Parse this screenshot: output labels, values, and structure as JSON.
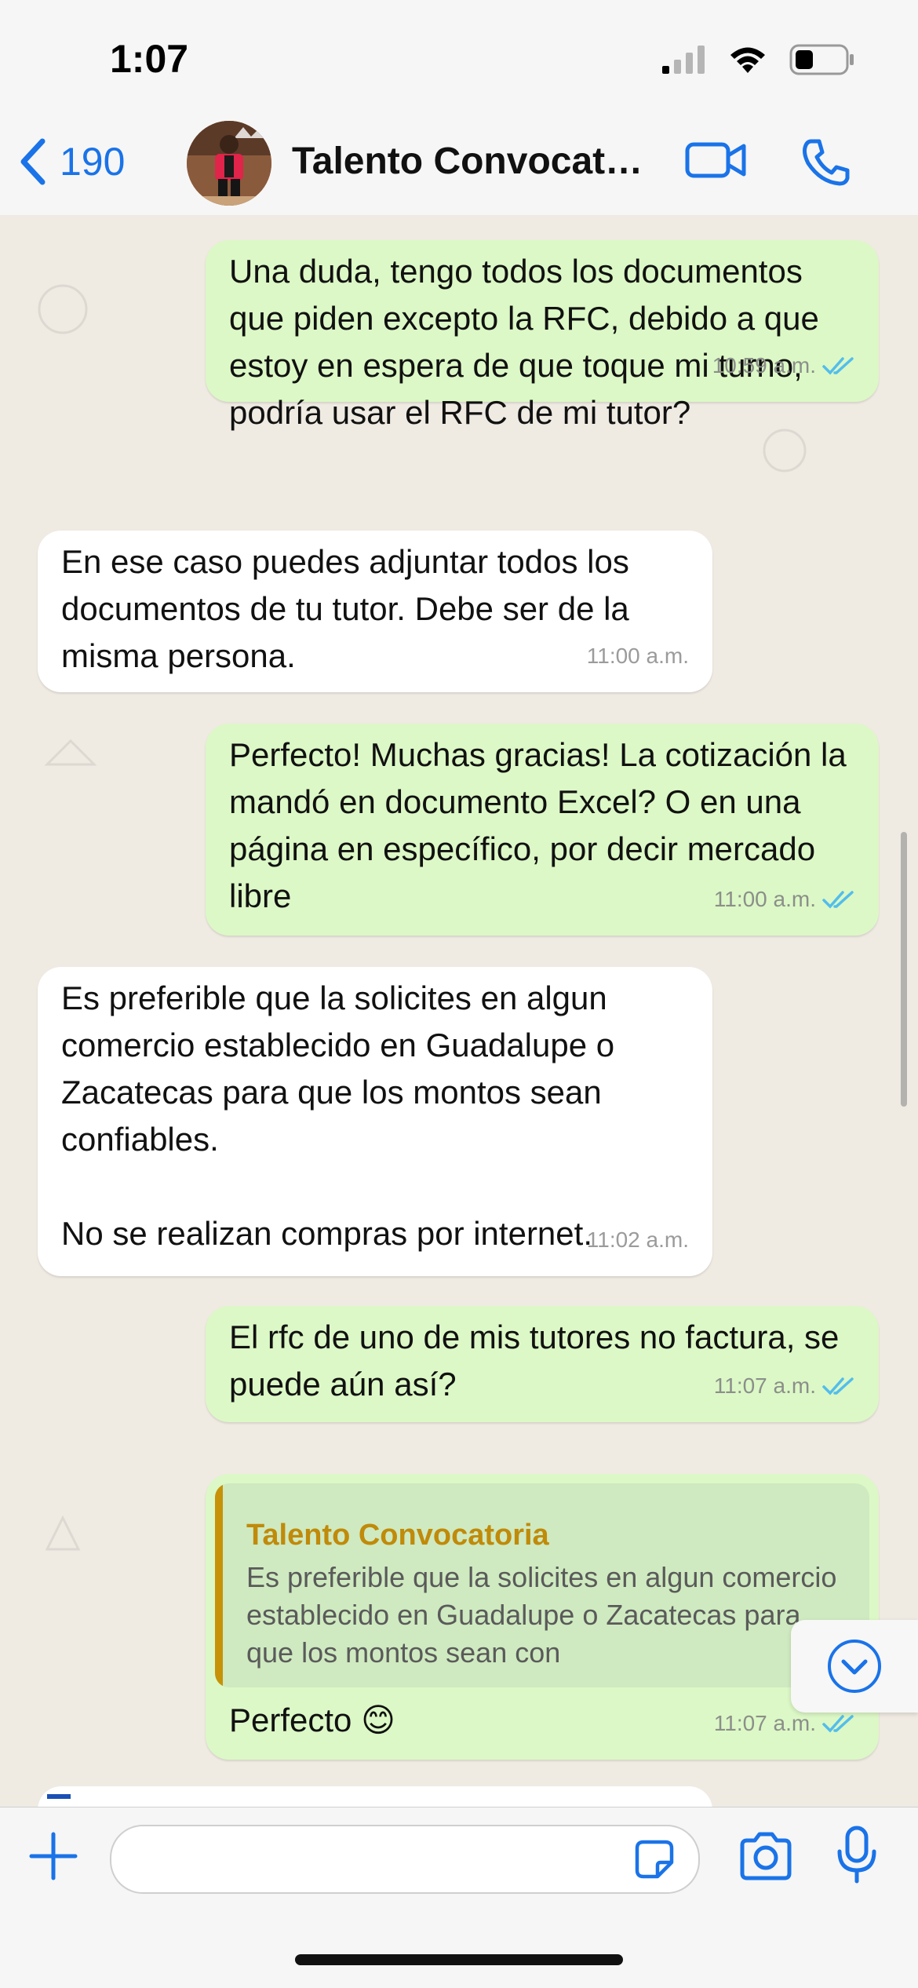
{
  "status_bar": {
    "time": "1:07"
  },
  "header": {
    "back_count": "190",
    "chat_title": "Talento Convocatoria",
    "icons": [
      "chevron-left-icon",
      "video-call-icon",
      "phone-icon"
    ]
  },
  "messages": [
    {
      "direction": "out",
      "text": "Una duda, tengo todos los documentos que piden excepto la RFC, debido a que estoy en espera de que toque mi turno, podría usar el RFC de mi tutor?",
      "time": "10:59 a.m.",
      "read": true
    },
    {
      "direction": "in",
      "text": "En ese caso puedes adjuntar todos los documentos de tu tutor. Debe ser de la misma persona.",
      "time": "11:00 a.m."
    },
    {
      "direction": "out",
      "text": "Perfecto! Muchas gracias! La cotización la mandó en documento Excel? O en una página en específico, por decir mercado libre",
      "time": "11:00 a.m.",
      "read": true
    },
    {
      "direction": "in",
      "text": "Es preferible que la solicites en algun comercio establecido en Guadalupe o Zacatecas para que los montos sean confiables.\n\nNo se realizan compras por internet.",
      "time": "11:02 a.m."
    },
    {
      "direction": "out",
      "text": "El rfc de uno de mis tutores no factura, se puede aún así?",
      "time": "11:07 a.m.",
      "read": true
    },
    {
      "direction": "out",
      "quote_author": "Talento Convocatoria",
      "quote_text": "Es preferible que la solicites en algun comercio establecido en Guadalupe o Zacatecas para que los montos sean con",
      "text": "Perfecto 😊",
      "time": "11:07 a.m.",
      "read": true
    }
  ],
  "composer": {
    "placeholder": ""
  },
  "colors": {
    "accent": "#1a73e8",
    "outgoing": "#dcf8c6",
    "incoming": "#ffffff",
    "read_ticks": "#53bdeb",
    "quote_author": "#c08a0a"
  }
}
